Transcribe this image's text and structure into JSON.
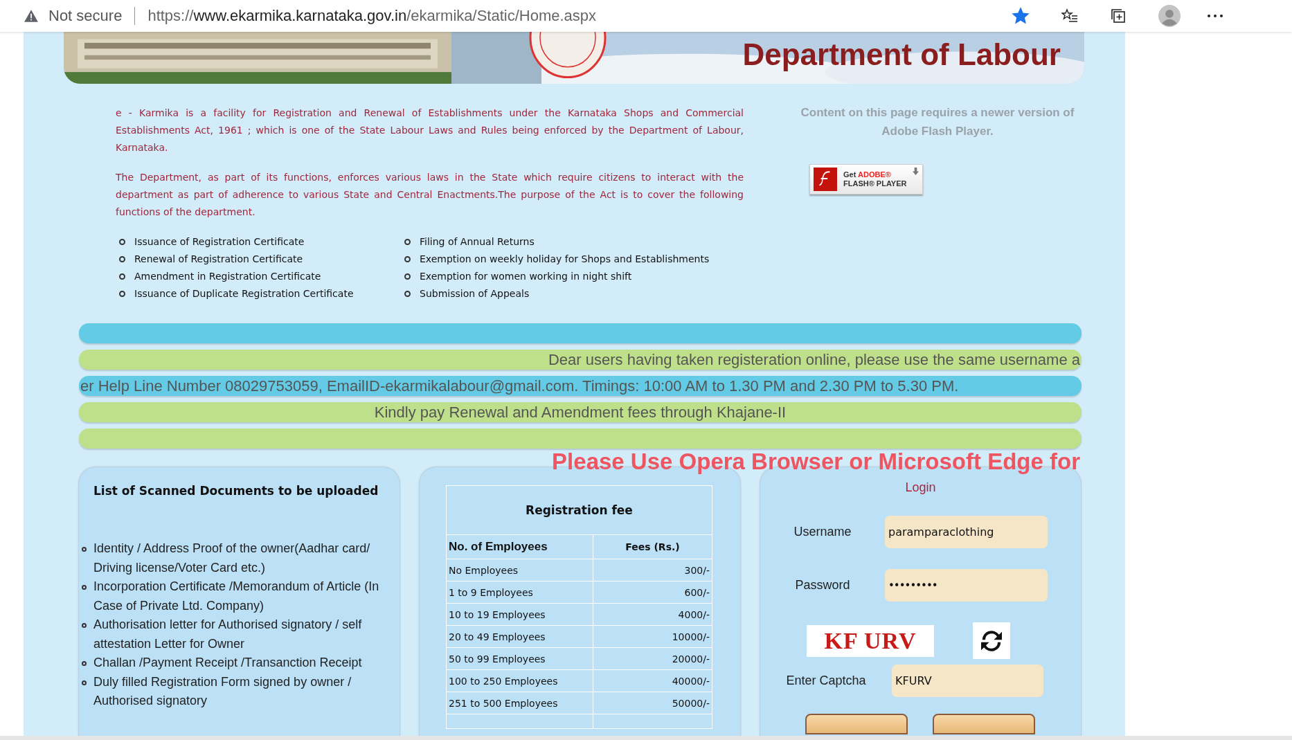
{
  "browser": {
    "security": "Not secure",
    "url_scheme": "https://",
    "url_domain": "www.ekarmika.karnataka.gov.in",
    "url_path": "/ekarmika/Static/Home.aspx",
    "bookmarked": true
  },
  "banner": {
    "title": "Department of Labour"
  },
  "intro": [
    "e - Karmika is a facility for Registration and Renewal of Establishments under the Karnataka Shops and Commercial Establishments Act, 1961 ; which is one of the State Labour Laws and Rules being enforced by the Department of Labour, Karnataka.",
    "The Department, as part of its functions, enforces various laws in the State which require citizens to interact with the department as part of adherence to various State and Central Enactments.The purpose of the Act is to cover the following functions of the department."
  ],
  "functions": [
    [
      "Issuance of Registration Certificate",
      "Renewal of Registration Certificate",
      "Amendment in Registration Certificate",
      "Issuance of Duplicate Registration Certificate"
    ],
    [
      "Filing of Annual Returns",
      "Exemption on weekly holiday for Shops and Establishments",
      "Exemption for women working in night shift",
      "Submission of Appeals"
    ]
  ],
  "flash": {
    "message": "Content on this page requires a newer version of Adobe Flash Player.",
    "badge_get": "Get",
    "badge_adobe": "ADOBE®",
    "badge_product": "FLASH® PLAYER"
  },
  "notices": [
    {
      "kind": "blank-blue"
    },
    {
      "kind": "ticker-green",
      "text": "Dear users having taken registeration online, please use the same username a"
    },
    {
      "kind": "ticker-blue",
      "text": "er Help Line Number 08029753059, EmailID-ekarmikalabour@gmail.com. Timings: 10:00 AM to 1.30 PM and 2.30 PM to 5.30 PM."
    },
    {
      "kind": "notice-green",
      "text": "Kindly pay Renewal and Amendment fees through Khajane-II"
    },
    {
      "kind": "blank-green"
    }
  ],
  "browser_warning": "Please Use Opera Browser or Microsoft Edge for",
  "documents": {
    "title": "List of Scanned Documents to be uploaded",
    "items": [
      "Identity / Address Proof of the owner(Aadhar card/ Driving license/Voter Card etc.)",
      "Incorporation Certificate /Memorandum of Article (In Case of Private Ltd. Company)",
      "Authorisation letter for Authorised signatory / self attestation Letter for Owner",
      "Challan /Payment Receipt /Transanction Receipt",
      "Duly filled Registration Form signed by owner / Authorised signatory"
    ]
  },
  "fees": {
    "title": "Registration fee",
    "columns": [
      "No. of Employees",
      "Fees (Rs.)"
    ],
    "rows": [
      [
        "No Employees",
        "300/-"
      ],
      [
        "1 to 9 Employees",
        "600/-"
      ],
      [
        "10 to 19 Employees",
        "4000/-"
      ],
      [
        "20 to 49 Employees",
        "10000/-"
      ],
      [
        "50 to 99 Employees",
        "20000/-"
      ],
      [
        "100 to 250 Employees",
        "40000/-"
      ],
      [
        "251 to 500 Employees",
        "50000/-"
      ]
    ]
  },
  "login": {
    "title": "Login",
    "username_label": "Username",
    "username": "paramparaclothing",
    "password_label": "Password",
    "password": "•••••••••",
    "captcha_image": "KF URV",
    "captcha_label": "Enter Captcha",
    "captcha": "KFURV"
  }
}
